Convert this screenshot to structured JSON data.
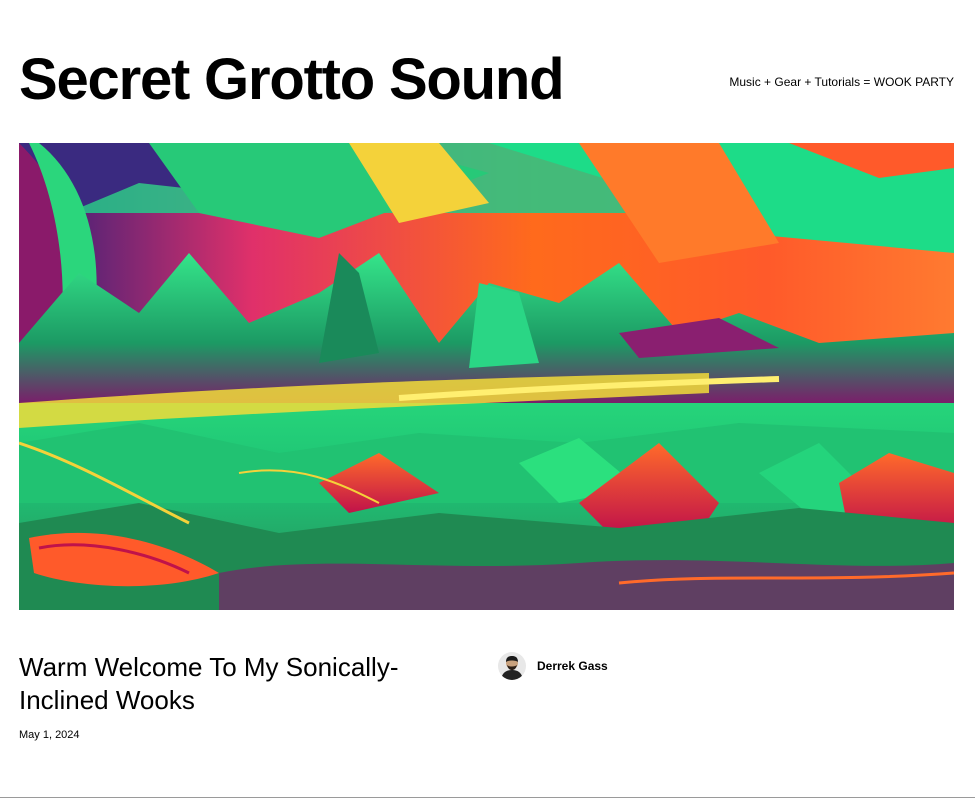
{
  "site": {
    "title": "Secret Grotto Sound",
    "tagline": "Music + Gear + Tutorials = WOOK PARTY"
  },
  "hero": {
    "image": "psychedelic-landscape-image",
    "colors": [
      "#2bd67c",
      "#ff5a1f",
      "#e0206e",
      "#6a1fa0",
      "#f7e13a"
    ]
  },
  "post": {
    "title": "Warm Welcome To My Sonically-Inclined Wooks",
    "date": "May 1, 2024",
    "author": {
      "name": "Derrek Gass",
      "avatar": "author-avatar"
    }
  }
}
